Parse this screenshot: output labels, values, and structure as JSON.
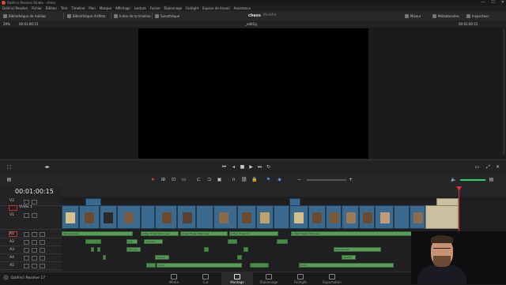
{
  "window": {
    "title": "DaVinci Resolve Studio - chess",
    "minimize": "—",
    "maximize": "☐",
    "close": "✕"
  },
  "menu": [
    "DaVinci Resolve",
    "Fichier",
    "Édition",
    "Trim",
    "Timeline",
    "Plan",
    "Marque",
    "Affichage",
    "Lecture",
    "Fusion",
    "Étalonnage",
    "Fairlight",
    "Espace de travail",
    "Assistance"
  ],
  "toolbar": {
    "media_pool": "Bibliothèque de médias",
    "effects": "Bibliothèque d'effets",
    "edit_index": "Index de la timeline",
    "sound_library": "Sonothèque",
    "project_name": "chess",
    "project_status": "Modifié",
    "mixer": "Mixeur",
    "metadata": "Métadonnées",
    "inspector": "Inspecteur"
  },
  "viewer": {
    "zoom": "29%",
    "timecode_left": "00:01:00:15",
    "clip_name": "_edit1g",
    "timecode_right": "00:01:00:15"
  },
  "timeline": {
    "timecode": "00:01:00:15",
    "tracks": [
      {
        "id": "V2",
        "type": "video"
      },
      {
        "id": "V1",
        "type": "video",
        "name": "Vidéo 1"
      },
      {
        "id": "A1",
        "type": "audio"
      },
      {
        "id": "A2",
        "type": "audio"
      },
      {
        "id": "A3",
        "type": "audio"
      },
      {
        "id": "A4",
        "type": "audio"
      },
      {
        "id": "A5",
        "type": "audio"
      }
    ],
    "audio_clips": [
      {
        "track": "A1",
        "label": "Terrazzo-wav"
      },
      {
        "track": "A1",
        "label": "A Epic Trailer Main wav"
      },
      {
        "track": "A1",
        "label": "A Epic Trailer Main wav"
      },
      {
        "track": "A1",
        "label": "A Epic Trailer M"
      },
      {
        "track": "A1",
        "label": "A Epic Trailer Main wav"
      },
      {
        "track": "A2",
        "label": "Clip"
      },
      {
        "track": "A2",
        "label": "Sea wav"
      },
      {
        "track": "A3",
        "label": "Sea wav"
      },
      {
        "track": "A3",
        "label": "Sea whoosh"
      },
      {
        "track": "A4",
        "label": "Sea Ppl"
      },
      {
        "track": "A4",
        "label": "Sea Ppl"
      },
      {
        "track": "A5",
        "label": "Crow"
      },
      {
        "track": "A5",
        "label": "Crow"
      }
    ]
  },
  "app_name": "DaVinci Resolve 17",
  "pages": [
    "Média",
    "Cut",
    "Montage",
    "Étalonnage",
    "Fairlight",
    "Exportation"
  ],
  "active_page": "Montage",
  "colors": {
    "accent": "#e03030",
    "video_clip": "#3b6a8e",
    "audio_clip": "#5a9a5a",
    "background": "#1e1e20"
  }
}
